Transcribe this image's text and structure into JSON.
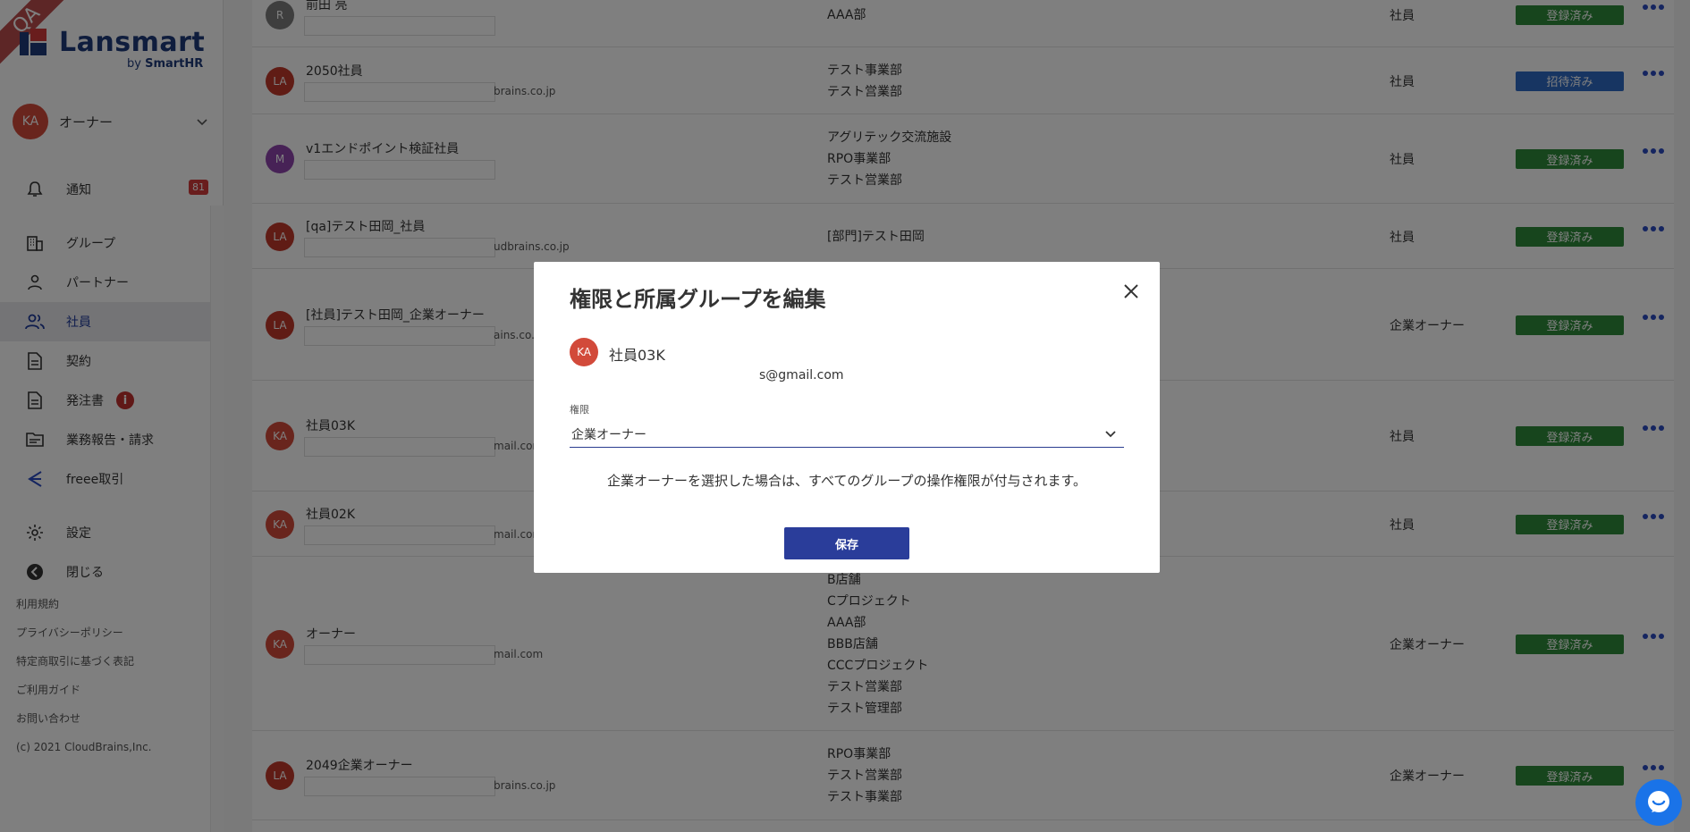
{
  "sidebar": {
    "qa_ribbon": "QA",
    "logo": {
      "name": "Lansmart",
      "sub_prefix": "by ",
      "sub_brand": "SmartHR"
    },
    "user": {
      "initials": "KA",
      "name": "オーナー"
    },
    "nav": [
      {
        "label": "通知",
        "badge": "81"
      },
      {
        "label": "グループ"
      },
      {
        "label": "パートナー"
      },
      {
        "label": "社員"
      },
      {
        "label": "契約"
      },
      {
        "label": "発注書",
        "badge": "i"
      },
      {
        "label": "業務報告・請求"
      },
      {
        "label": "freee取引"
      },
      {
        "label": "設定"
      },
      {
        "label": "閉じる"
      }
    ],
    "footer_links": [
      "利用規約",
      "プライバシーポリシー",
      "特定商取引に基づく表記",
      "ご利用ガイド",
      "お問い合わせ"
    ],
    "copyright": "(c) 2021 CloudBrains,Inc."
  },
  "rows": [
    {
      "initials": "R",
      "name": "前田 亮",
      "email_tail": "",
      "groups": [
        "AAA部"
      ],
      "role": "社員",
      "status": "登録済み",
      "status_color": "#2e8b3a",
      "avatar_color": "#7d7d7d"
    },
    {
      "initials": "LA",
      "name": "2050社員",
      "email_tail": "brains.co.jp",
      "groups": [
        "テスト事業部",
        "テスト営業部"
      ],
      "role": "社員",
      "status": "招待済み",
      "status_color": "#2f6bc4",
      "avatar_color": "#c0392b"
    },
    {
      "initials": "M",
      "name": "v1エンドポイント検証社員",
      "email_tail": "",
      "groups": [
        "アグリテック交流施設",
        "RPO事業部",
        "テスト営業部"
      ],
      "role": "社員",
      "status": "登録済み",
      "status_color": "#2e8b3a",
      "avatar_color": "#8e44ad"
    },
    {
      "initials": "LA",
      "name": "[qa]テスト田岡_社員",
      "email_tail": "udbrains.co.jp",
      "groups": [
        "[部門]テスト田岡"
      ],
      "role": "社員",
      "status": "登録済み",
      "status_color": "#2e8b3a",
      "avatar_color": "#c0392b"
    },
    {
      "initials": "LA",
      "name": "[社員]テスト田岡_企業オーナー",
      "email_tail": "ains.co.jp",
      "groups": [],
      "role": "企業オーナー",
      "status": "登録済み",
      "status_color": "#2e8b3a",
      "avatar_color": "#c0392b"
    },
    {
      "initials": "KA",
      "name": "社員03K",
      "email_tail": "mail.com",
      "groups": [],
      "role": "社員",
      "status": "登録済み",
      "status_color": "#2e8b3a",
      "avatar_color": "#d24a3a"
    },
    {
      "initials": "KA",
      "name": "社員02K",
      "email_tail": "mail.com",
      "groups": [],
      "role": "社員",
      "status": "登録済み",
      "status_color": "#2e8b3a",
      "avatar_color": "#d24a3a"
    },
    {
      "initials": "KA",
      "name": "オーナー",
      "email_tail": "mail.com",
      "groups": [
        "B店舗",
        "Cプロジェクト",
        "AAA部",
        "BBB店舗",
        "CCCプロジェクト",
        "テスト営業部",
        "テスト管理部"
      ],
      "role": "企業オーナー",
      "status": "登録済み",
      "status_color": "#2e8b3a",
      "avatar_color": "#d24a3a"
    },
    {
      "initials": "LA",
      "name": "2049企業オーナー",
      "email_tail": "brains.co.jp",
      "groups": [
        "RPO事業部",
        "テスト営業部",
        "テスト事業部"
      ],
      "role": "企業オーナー",
      "status": "登録済み",
      "status_color": "#2e8b3a",
      "avatar_color": "#c0392b"
    }
  ],
  "modal": {
    "title": "権限と所属グループを編集",
    "user_initials": "KA",
    "user_name": "社員03K",
    "email_tail": "s@gmail.com",
    "role_label": "権限",
    "role_value": "企業オーナー",
    "note": "企業オーナーを選択した場合は、すべてのグループの操作権限が付与されます。",
    "save_label": "保存"
  },
  "colors": {
    "accent": "#2a3d9a",
    "registered": "#2e8b3a",
    "invited": "#2f6bc4"
  }
}
